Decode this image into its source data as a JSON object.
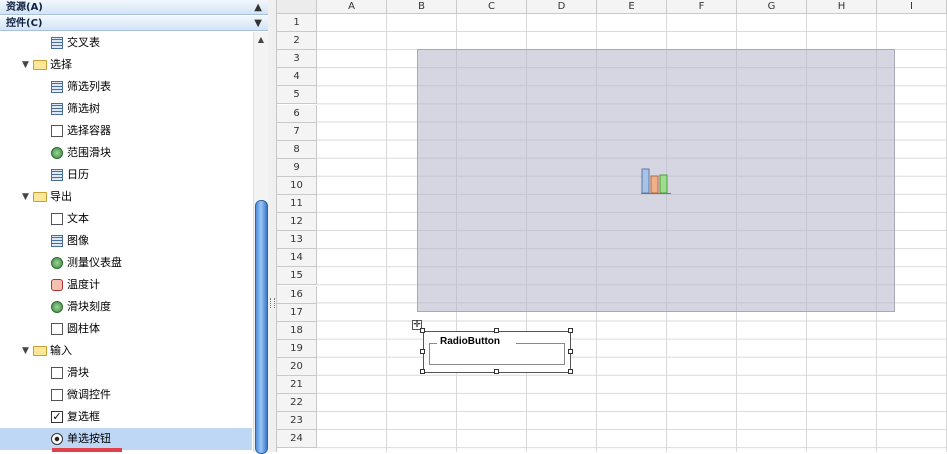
{
  "panels": {
    "resources": {
      "label": "资源(A)"
    },
    "controls": {
      "label": "控件(C)"
    }
  },
  "tree": [
    {
      "label": "交叉表",
      "level": 2,
      "icon": "crosstab-icon"
    },
    {
      "label": "选择",
      "level": 1,
      "icon": "folder-icon",
      "expanded": true
    },
    {
      "label": "筛选列表",
      "level": 2,
      "icon": "filter-list-icon"
    },
    {
      "label": "筛选树",
      "level": 2,
      "icon": "filter-tree-icon"
    },
    {
      "label": "选择容器",
      "level": 2,
      "icon": "selection-container-icon"
    },
    {
      "label": "范围滑块",
      "level": 2,
      "icon": "range-slider-icon"
    },
    {
      "label": "日历",
      "level": 2,
      "icon": "calendar-icon"
    },
    {
      "label": "导出",
      "level": 1,
      "icon": "folder-icon",
      "expanded": true
    },
    {
      "label": "文本",
      "level": 2,
      "icon": "text-icon"
    },
    {
      "label": "图像",
      "level": 2,
      "icon": "image-icon"
    },
    {
      "label": "测量仪表盘",
      "level": 2,
      "icon": "gauge-icon"
    },
    {
      "label": "温度计",
      "level": 2,
      "icon": "thermometer-icon"
    },
    {
      "label": "滑块刻度",
      "level": 2,
      "icon": "slider-scale-icon"
    },
    {
      "label": "圆柱体",
      "level": 2,
      "icon": "cylinder-icon"
    },
    {
      "label": "输入",
      "level": 1,
      "icon": "folder-icon",
      "expanded": true
    },
    {
      "label": "滑块",
      "level": 2,
      "icon": "slider-icon"
    },
    {
      "label": "微调控件",
      "level": 2,
      "icon": "spinner-icon"
    },
    {
      "label": "复选框",
      "level": 2,
      "icon": "checkbox-icon"
    },
    {
      "label": "单选按钮",
      "level": 2,
      "icon": "radio-button-icon",
      "selected": true
    }
  ],
  "sheet": {
    "columns": [
      "A",
      "B",
      "C",
      "D",
      "E",
      "F",
      "G",
      "H",
      "I"
    ],
    "rows": [
      "1",
      "2",
      "3",
      "4",
      "5",
      "6",
      "7",
      "8",
      "9",
      "10",
      "11",
      "12",
      "13",
      "14",
      "15",
      "16",
      "17",
      "18",
      "19",
      "20",
      "21",
      "22",
      "23",
      "24"
    ]
  },
  "widgets": {
    "radio_label": "RadioButton"
  },
  "colors": {
    "selection": "#bdd7f5",
    "chart_placeholder": "#b2b4c8",
    "scroll_thumb": "#4f8fdc",
    "highlight_bar": "#e0414a"
  }
}
